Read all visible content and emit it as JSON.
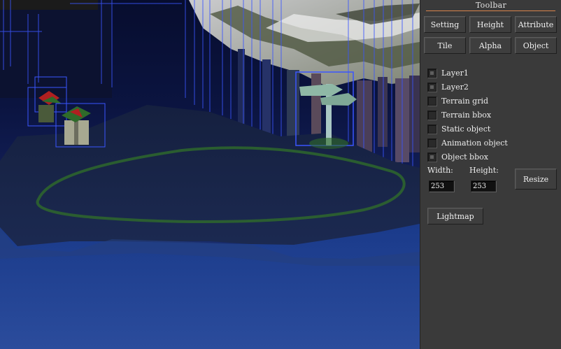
{
  "toolbar": {
    "title": "Toolbar",
    "buttons_row1": [
      "Setting",
      "Height",
      "Attribute"
    ],
    "buttons_row2": [
      "Tile",
      "Alpha",
      "Object"
    ],
    "checkboxes": [
      {
        "label": "Layer1",
        "checked": true
      },
      {
        "label": "Layer2",
        "checked": true
      },
      {
        "label": "Terrain grid",
        "checked": false
      },
      {
        "label": "Terrain bbox",
        "checked": false
      },
      {
        "label": "Static object",
        "checked": false
      },
      {
        "label": "Animation object",
        "checked": false
      },
      {
        "label": "Object bbox",
        "checked": true
      }
    ],
    "width_label": "Width:",
    "height_label": "Height:",
    "width_value": "253",
    "height_value": "253",
    "resize_label": "Resize",
    "lightmap_label": "Lightmap"
  },
  "colors": {
    "panel_bg": "#3a3a3a",
    "title_underline": "#d9844c",
    "bbox_wire": "#3a55ff",
    "terrain_grid_highlight": "#2f6b2a"
  }
}
